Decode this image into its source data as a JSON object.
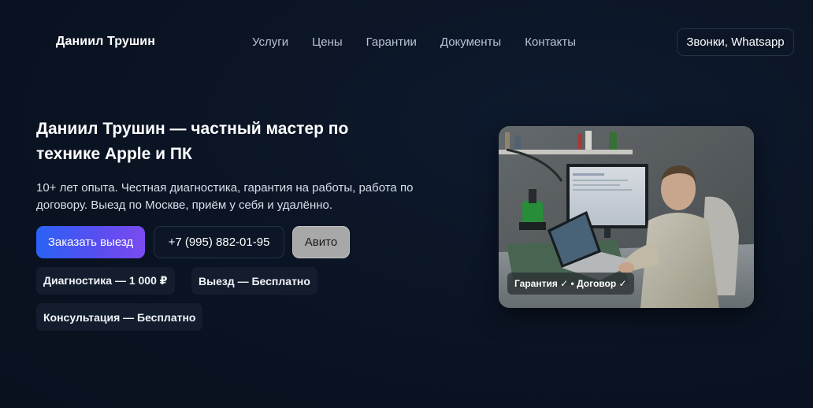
{
  "header": {
    "brand": "Даниил Трушин",
    "nav": [
      "Услуги",
      "Цены",
      "Гарантии",
      "Документы",
      "Контакты"
    ],
    "calls_label": "Звонки, Whatsapp"
  },
  "hero": {
    "title": "Даниил Трушин — частный мастер по технике Apple и ПК",
    "subtitle": "10+ лет опыта. Честная диагностика, гарантия на работы, работа по договору. Выезд по Москве, приём у себя и удалённо.",
    "buttons": {
      "order": "Заказать выезд",
      "phone": "+7 (995) 882-01-95",
      "avito": "Авито"
    },
    "chips": [
      "Диагностика — 1 000 ₽",
      "Выезд — Бесплатно",
      "Консультация — Бесплатно"
    ]
  },
  "photo": {
    "badge": "Гарантия ✓ • Договор ✓"
  },
  "colors": {
    "background": "#0b1424",
    "accent_start": "#2a62f5",
    "accent_end": "#7b4cf0",
    "chip_bg": "#131d2d",
    "avito_bg": "#a8a8a8"
  }
}
